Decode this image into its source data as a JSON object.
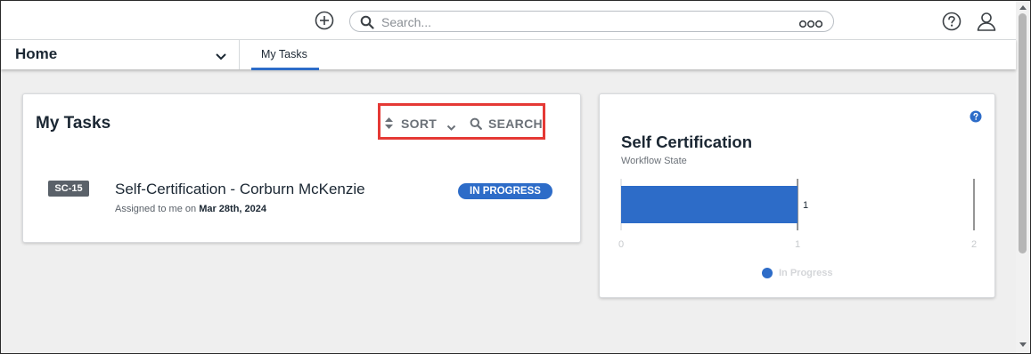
{
  "header": {
    "search_placeholder": "Search...",
    "icons": [
      "plus-circle-icon",
      "search-icon",
      "options-icon",
      "help-icon",
      "user-icon"
    ]
  },
  "nav": {
    "home_label": "Home",
    "tabs": [
      {
        "label": "My Tasks",
        "active": true
      }
    ]
  },
  "tasks_card": {
    "title": "My Tasks",
    "sort_label": "SORT",
    "search_label": "SEARCH",
    "tasks": [
      {
        "id": "SC-15",
        "title": "Self-Certification - Corburn McKenzie",
        "assigned_prefix": "Assigned to me on",
        "assigned_date": "Mar 28th, 2024",
        "status": "IN PROGRESS"
      }
    ]
  },
  "cert_card": {
    "title": "Self Certification",
    "subtitle": "Workflow State",
    "legend": [
      {
        "label": "In Progress",
        "color": "#2d6cc8"
      }
    ]
  },
  "chart_data": {
    "type": "bar",
    "orientation": "horizontal",
    "categories": [
      "In Progress"
    ],
    "values": [
      1
    ],
    "data_labels": [
      "1"
    ],
    "xticks": [
      "0",
      "1",
      "2"
    ],
    "xlim": [
      0,
      2
    ],
    "legend_position": "bottom",
    "color": "#2d6cc8"
  },
  "colors": {
    "accent": "#2d6cc8",
    "highlight_border": "#e53935",
    "badge_gray": "#5a6169"
  }
}
